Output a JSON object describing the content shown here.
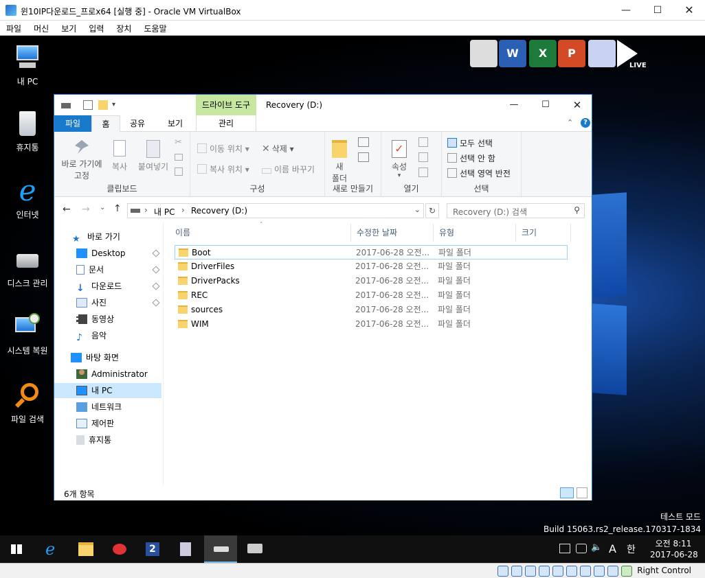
{
  "vbox": {
    "title": "윈10IP다운로드_프로x64 [실행 중] - Oracle VM VirtualBox",
    "menu": [
      "파일",
      "머신",
      "보기",
      "입력",
      "장치",
      "도움말"
    ],
    "status_host_key": "Right Control"
  },
  "desktop": {
    "icons": [
      {
        "label": "내 PC",
        "icon": "computer-icon"
      },
      {
        "label": "휴지통",
        "icon": "recycle-bin-icon"
      },
      {
        "label": "인터넷",
        "icon": "internet-explorer-icon"
      },
      {
        "label": "디스크 관리",
        "icon": "disk-management-icon"
      },
      {
        "label": "시스템 복원",
        "icon": "system-restore-icon"
      },
      {
        "label": "파일 검색",
        "icon": "search-icon"
      }
    ],
    "overlay_live_label": "LIVE",
    "watermark": {
      "mode": "테스트 모드",
      "build": "Build 15063.rs2_release.170317-1834"
    }
  },
  "explorer": {
    "title": "Recovery (D:)",
    "drive_tools": "드라이브 도구",
    "tabs": [
      "파일",
      "홈",
      "공유",
      "보기"
    ],
    "manage_tab": "관리",
    "ribbon": {
      "clipboard": {
        "pin": "바로 가기에",
        "pin2": "고정",
        "copy": "복사",
        "paste": "붙여넣기",
        "label": "클립보드"
      },
      "organize": {
        "move": "이동 위치",
        "copy_to": "복사 위치",
        "delete": "삭제",
        "rename": "이름 바꾸기",
        "label": "구성"
      },
      "new": {
        "folder1": "새",
        "folder2": "폴더",
        "label": "새로 만들기"
      },
      "open": {
        "properties": "속성",
        "label": "열기"
      },
      "select": {
        "all": "모두 선택",
        "none": "선택 안 함",
        "invert": "선택 영역 반전",
        "label": "선택"
      }
    },
    "address": {
      "crumbs": [
        "내 PC",
        "Recovery (D:)"
      ],
      "search_placeholder": "Recovery (D:) 검색"
    },
    "nav": {
      "quick_access": "바로 가기",
      "pinned": [
        {
          "label": "Desktop",
          "icon": "desktop-folder-icon",
          "color": "#1e90ff"
        },
        {
          "label": "문서",
          "icon": "documents-icon",
          "color": "#6a8fc4"
        },
        {
          "label": "다운로드",
          "icon": "downloads-icon",
          "color": "#2f6fdd"
        },
        {
          "label": "사진",
          "icon": "pictures-icon",
          "color": "#6a8fc4"
        }
      ],
      "libraries": [
        {
          "label": "동영상",
          "icon": "videos-icon"
        },
        {
          "label": "음악",
          "icon": "music-icon"
        }
      ],
      "desktop_label": "바탕 화면",
      "desktop_children": [
        {
          "label": "Administrator",
          "icon": "user-icon"
        },
        {
          "label": "내 PC",
          "icon": "computer-icon"
        },
        {
          "label": "네트워크",
          "icon": "network-icon"
        },
        {
          "label": "제어판",
          "icon": "control-panel-icon"
        },
        {
          "label": "휴지통",
          "icon": "recycle-bin-icon"
        }
      ]
    },
    "columns": {
      "name": "이름",
      "modified": "수정한 날짜",
      "type": "유형",
      "size": "크기"
    },
    "files": [
      {
        "name": "Boot",
        "modified": "2017-06-28 오전...",
        "type": "파일 폴더"
      },
      {
        "name": "DriverFiles",
        "modified": "2017-06-28 오전...",
        "type": "파일 폴더"
      },
      {
        "name": "DriverPacks",
        "modified": "2017-06-28 오전...",
        "type": "파일 폴더"
      },
      {
        "name": "REC",
        "modified": "2017-06-28 오전...",
        "type": "파일 폴더"
      },
      {
        "name": "sources",
        "modified": "2017-06-28 오전...",
        "type": "파일 폴더"
      },
      {
        "name": "WIM",
        "modified": "2017-06-28 오전...",
        "type": "파일 폴더"
      }
    ],
    "item_count": "6개 항목"
  },
  "taskbar": {
    "clock_time": "오전 8:11",
    "clock_date": "2017-06-28",
    "ime_letter": "A",
    "ime_hangul": "한"
  }
}
